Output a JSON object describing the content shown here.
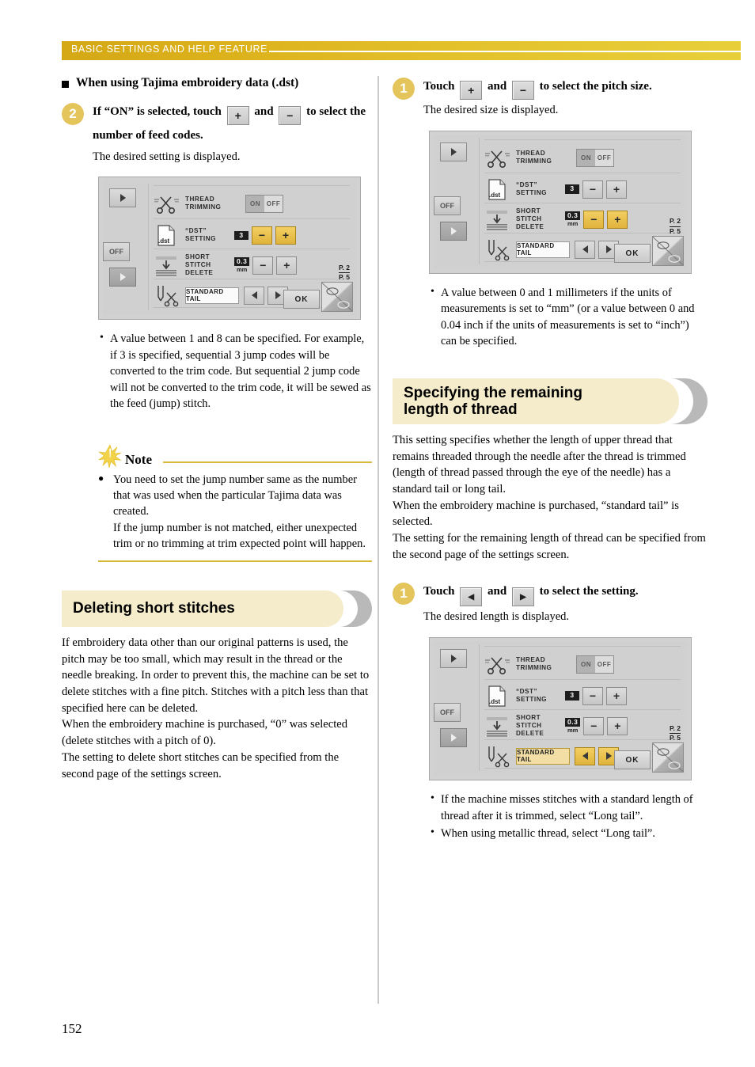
{
  "header": {
    "title": "BASIC SETTINGS AND HELP FEATURE"
  },
  "page_number": "152",
  "left_column": {
    "subhead": "When using Tajima embroidery data (.dst)",
    "step": {
      "number": "2",
      "title_part1": "If “ON” is selected, touch",
      "key_plus": "+",
      "title_and": "and",
      "key_minus": "−",
      "title_part2": "to select the number of feed codes.",
      "subtitle": "The desired setting is displayed."
    },
    "lcd": {
      "left_buttons": {
        "top_arrow": "▶",
        "off_label": "OFF",
        "bottom_arrow": "▶"
      },
      "rows": [
        {
          "label": "THREAD\nTRIMMING",
          "icon": "scissors-icon",
          "control": "onoff",
          "on": "ON",
          "off": "OFF"
        },
        {
          "label": "“DST”\nSETTING",
          "icon": "dst-file-icon",
          "value": "3",
          "unit": "",
          "minus": "−",
          "plus": "+",
          "highlight": true
        },
        {
          "label": "SHORT\nSTITCH\nDELETE",
          "icon": "short-stitch-icon",
          "value": "0.3",
          "unit": "mm",
          "minus": "−",
          "plus": "+",
          "highlight": false
        },
        {
          "label": "",
          "icon": "needle-scissors-icon",
          "tail": "STANDARD TAIL",
          "left": "◀",
          "right": "▶",
          "highlight": false
        }
      ],
      "page_top": "P. 2",
      "page_bottom": "P. 5",
      "ok": "OK"
    },
    "bullets": [
      "A value between 1 and 8 can be specified. For example, if 3 is specified, sequential 3 jump codes will be converted to the trim code. But sequential 2 jump code will not be converted to the trim code, it will be sewed as the feed (jump) stitch."
    ],
    "note": {
      "title": "Note",
      "items": [
        "You need to set the jump number same as the number that was used when the particular Tajima data was created.\nIf the jump number is not matched, either unexpected trim or no trimming at trim expected point will happen."
      ]
    },
    "section": {
      "title": "Deleting short stitches",
      "body": "If embroidery data other than our original patterns is used, the pitch may be too small, which may result in the thread or the needle breaking. In order to prevent this, the machine can be set to delete stitches with a fine pitch. Stitches with a pitch less than that specified here can be deleted.\nWhen the embroidery machine is purchased, “0” was selected (delete stitches with a pitch of 0).\nThe setting to delete short stitches can be specified from the second page of the settings screen."
    }
  },
  "right_column": {
    "step1": {
      "number": "1",
      "title_part1": "Touch",
      "key_plus": "+",
      "title_and": "and",
      "key_minus": "−",
      "title_part2": "to select the pitch size.",
      "subtitle": "The desired size is displayed."
    },
    "lcd1": {
      "left_buttons": {
        "top_arrow": "▶",
        "off_label": "OFF",
        "bottom_arrow": "▶"
      },
      "rows": [
        {
          "label": "THREAD\nTRIMMING",
          "icon": "scissors-icon",
          "control": "onoff",
          "on": "ON",
          "off": "OFF"
        },
        {
          "label": "“DST”\nSETTING",
          "icon": "dst-file-icon",
          "value": "3",
          "unit": "",
          "minus": "−",
          "plus": "+",
          "highlight": false
        },
        {
          "label": "SHORT\nSTITCH\nDELETE",
          "icon": "short-stitch-icon",
          "value": "0.3",
          "unit": "mm",
          "minus": "−",
          "plus": "+",
          "highlight": true
        },
        {
          "label": "",
          "icon": "needle-scissors-icon",
          "tail": "STANDARD TAIL",
          "left": "◀",
          "right": "▶",
          "highlight": false
        }
      ],
      "page_top": "P. 2",
      "page_bottom": "P. 5",
      "ok": "OK"
    },
    "bullets1": [
      "A value between 0 and 1 millimeters if the units of measurements is set to “mm” (or a value between 0 and 0.04 inch if the units of measurements is set to “inch”) can be specified."
    ],
    "section": {
      "title_line1": "Specifying the remaining",
      "title_line2": "length of thread",
      "body": "This setting specifies whether the length of upper thread that remains threaded through the needle after the thread is trimmed (length of thread passed through the eye of the needle) has a standard tail or long tail.\nWhen the embroidery machine is purchased, “standard tail” is selected.\nThe setting for the remaining length of thread can be specified from the second page of the settings screen."
    },
    "step2": {
      "number": "1",
      "title_part1": "Touch",
      "key_left": "◀",
      "title_and": "and",
      "key_right": "▶",
      "title_part2": "to select the setting.",
      "subtitle": "The desired length is displayed."
    },
    "lcd2": {
      "left_buttons": {
        "top_arrow": "▶",
        "off_label": "OFF",
        "bottom_arrow": "▶"
      },
      "rows": [
        {
          "label": "THREAD\nTRIMMING",
          "icon": "scissors-icon",
          "control": "onoff",
          "on": "ON",
          "off": "OFF"
        },
        {
          "label": "“DST”\nSETTING",
          "icon": "dst-file-icon",
          "value": "3",
          "unit": "",
          "minus": "−",
          "plus": "+",
          "highlight": false
        },
        {
          "label": "SHORT\nSTITCH\nDELETE",
          "icon": "short-stitch-icon",
          "value": "0.3",
          "unit": "mm",
          "minus": "−",
          "plus": "+",
          "highlight": false
        },
        {
          "label": "",
          "icon": "needle-scissors-icon",
          "tail": "STANDARD TAIL",
          "left": "◀",
          "right": "▶",
          "highlight": true
        }
      ],
      "page_top": "P. 2",
      "page_bottom": "P. 5",
      "ok": "OK"
    },
    "bullets2": [
      "If the machine misses stitches with a standard length of thread after it is trimmed, select “Long tail”.",
      "When using metallic thread, select “Long tail”."
    ]
  },
  "colors": {
    "header_gold": "#d5a816",
    "badge_gold": "#e4c55c",
    "section_cream": "#f4eccb",
    "section_gray": "#b9b9b9",
    "highlight_amber": "#e8bd45",
    "note_rule": "#d9b93a"
  }
}
